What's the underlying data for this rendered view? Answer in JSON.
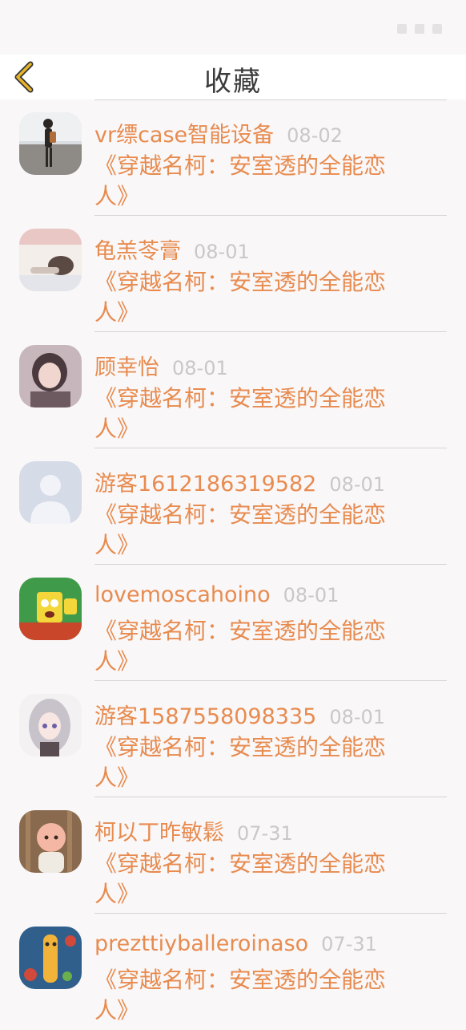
{
  "header": {
    "title": "收藏"
  },
  "items": [
    {
      "name": "vr缥case智能设备",
      "date": "08-02",
      "content": "《穿越名柯：安室透的全能恋人》"
    },
    {
      "name": "龟羔苓膏",
      "date": "08-01",
      "content": "《穿越名柯：安室透的全能恋人》"
    },
    {
      "name": "顾幸怡",
      "date": "08-01",
      "content": "《穿越名柯：安室透的全能恋人》"
    },
    {
      "name": "游客1612186319582",
      "date": "08-01",
      "content": "《穿越名柯：安室透的全能恋人》"
    },
    {
      "name": "lovemoscahoino",
      "date": "08-01",
      "content": "《穿越名柯：安室透的全能恋人》"
    },
    {
      "name": "游客1587558098335",
      "date": "08-01",
      "content": "《穿越名柯：安室透的全能恋人》"
    },
    {
      "name": "柯以丁昨敏鬆",
      "date": "07-31",
      "content": "《穿越名柯：安室透的全能恋人》"
    },
    {
      "name": "prezttiyballeroinaso",
      "date": "07-31",
      "content": "《穿越名柯：安室透的全能恋人》"
    }
  ],
  "colors": {
    "accent": "#e88b4f",
    "date": "#c9c7c8",
    "background": "#f9f7f8",
    "back_arrow": "#e7b42b"
  },
  "icons": {
    "back": "chevron-left-icon"
  }
}
